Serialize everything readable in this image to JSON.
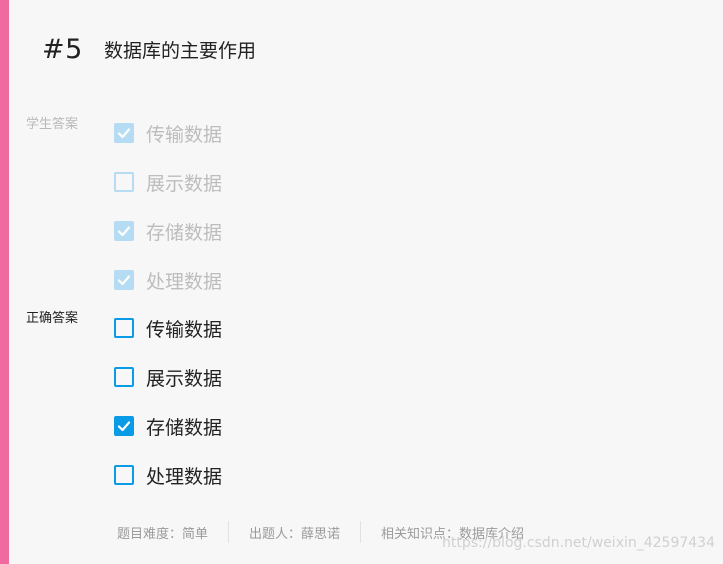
{
  "question": {
    "number": "#5",
    "title": "数据库的主要作用"
  },
  "student_answer": {
    "label": "学生答案",
    "options": [
      {
        "text": "传输数据",
        "checked": true
      },
      {
        "text": "展示数据",
        "checked": false
      },
      {
        "text": "存储数据",
        "checked": true
      },
      {
        "text": "处理数据",
        "checked": true
      }
    ]
  },
  "correct_answer": {
    "label": "正确答案",
    "options": [
      {
        "text": "传输数据",
        "checked": false
      },
      {
        "text": "展示数据",
        "checked": false
      },
      {
        "text": "存储数据",
        "checked": true
      },
      {
        "text": "处理数据",
        "checked": false
      }
    ]
  },
  "meta": {
    "difficulty": "题目难度：简单",
    "author": "出题人：薛思诺",
    "knowledge": "相关知识点：数据库介绍"
  },
  "watermark": "https://blog.csdn.net/weixin_42597434",
  "colors": {
    "accent": "#f06aa0",
    "checkbox": "#0a9be6",
    "checkbox_faded": "#b5dcf3"
  }
}
